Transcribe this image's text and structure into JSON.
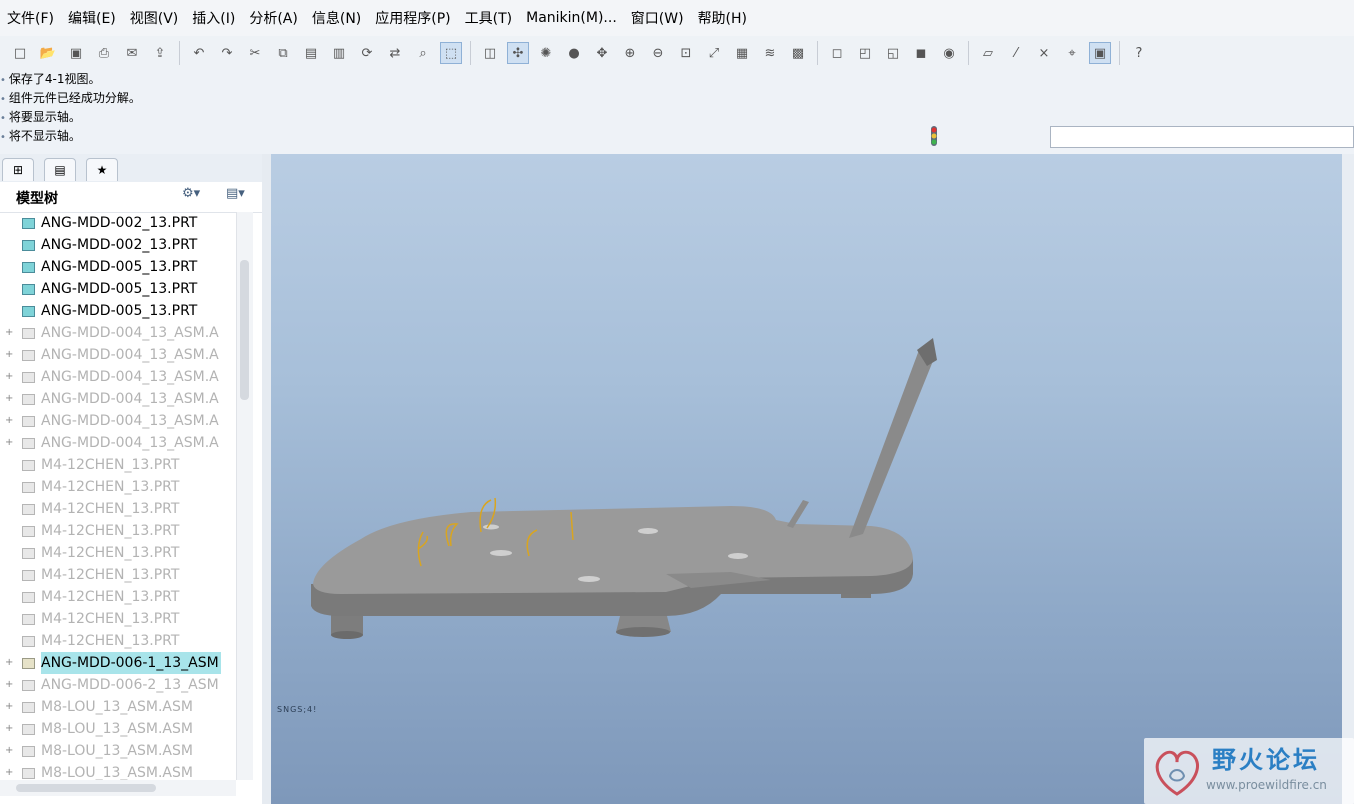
{
  "menu": [
    "文件(F)",
    "编辑(E)",
    "视图(V)",
    "插入(I)",
    "分析(A)",
    "信息(N)",
    "应用程序(P)",
    "工具(T)",
    "Manikin(M)...",
    "窗口(W)",
    "帮助(H)"
  ],
  "toolbar_groups": [
    [
      "new-file-icon",
      "open-file-icon",
      "save-icon",
      "print-icon",
      "email-icon",
      "send-icon"
    ],
    [
      "undo-icon",
      "redo-icon",
      "cut-icon",
      "copy-icon",
      "paste-icon",
      "paste-special-icon",
      "regenerate-icon",
      "regen-manager-icon",
      "find-icon",
      "select-box-icon"
    ],
    [
      "repaint-icon",
      "spin-center-icon",
      "orient-icon",
      "appearance-icon",
      "pan-icon",
      "zoom-in-icon",
      "zoom-out-icon",
      "refit-icon",
      "reorient-icon",
      "saved-views-icon",
      "layers-icon",
      "view-manager-icon"
    ],
    [
      "wireframe-icon",
      "hidden-line-icon",
      "no-hidden-icon",
      "shading-icon",
      "display-style-icon"
    ],
    [
      "datum-planes-icon",
      "datum-axes-icon",
      "datum-points-icon",
      "coordinate-systems-icon",
      "annotations-icon"
    ],
    [
      "context-help-icon"
    ]
  ],
  "messages": [
    "保存了4-1视图。",
    "组件元件已经成功分解。",
    "将要显示轴。",
    "将不显示轴。"
  ],
  "command_input": {
    "value": ""
  },
  "panel_tabs": [
    "model-tree-tab-icon",
    "layer-tree-tab-icon",
    "favorites-tab-icon"
  ],
  "tree": {
    "title": "模型树",
    "items": [
      {
        "label": "ANG-MDD-002_13.PRT",
        "kind": "part",
        "dim": false,
        "expand": false,
        "selected": false
      },
      {
        "label": "ANG-MDD-002_13.PRT",
        "kind": "part",
        "dim": false,
        "expand": false,
        "selected": false
      },
      {
        "label": "ANG-MDD-005_13.PRT",
        "kind": "part",
        "dim": false,
        "expand": false,
        "selected": false
      },
      {
        "label": "ANG-MDD-005_13.PRT",
        "kind": "part",
        "dim": false,
        "expand": false,
        "selected": false
      },
      {
        "label": "ANG-MDD-005_13.PRT",
        "kind": "part",
        "dim": false,
        "expand": false,
        "selected": false
      },
      {
        "label": "ANG-MDD-004_13_ASM.A",
        "kind": "asm",
        "dim": true,
        "expand": true,
        "selected": false
      },
      {
        "label": "ANG-MDD-004_13_ASM.A",
        "kind": "asm",
        "dim": true,
        "expand": true,
        "selected": false
      },
      {
        "label": "ANG-MDD-004_13_ASM.A",
        "kind": "asm",
        "dim": true,
        "expand": true,
        "selected": false
      },
      {
        "label": "ANG-MDD-004_13_ASM.A",
        "kind": "asm",
        "dim": true,
        "expand": true,
        "selected": false
      },
      {
        "label": "ANG-MDD-004_13_ASM.A",
        "kind": "asm",
        "dim": true,
        "expand": true,
        "selected": false
      },
      {
        "label": "ANG-MDD-004_13_ASM.A",
        "kind": "asm",
        "dim": true,
        "expand": true,
        "selected": false
      },
      {
        "label": "M4-12CHEN_13.PRT",
        "kind": "part",
        "dim": true,
        "expand": false,
        "selected": false
      },
      {
        "label": "M4-12CHEN_13.PRT",
        "kind": "part",
        "dim": true,
        "expand": false,
        "selected": false
      },
      {
        "label": "M4-12CHEN_13.PRT",
        "kind": "part",
        "dim": true,
        "expand": false,
        "selected": false
      },
      {
        "label": "M4-12CHEN_13.PRT",
        "kind": "part",
        "dim": true,
        "expand": false,
        "selected": false
      },
      {
        "label": "M4-12CHEN_13.PRT",
        "kind": "part",
        "dim": true,
        "expand": false,
        "selected": false
      },
      {
        "label": "M4-12CHEN_13.PRT",
        "kind": "part",
        "dim": true,
        "expand": false,
        "selected": false
      },
      {
        "label": "M4-12CHEN_13.PRT",
        "kind": "part",
        "dim": true,
        "expand": false,
        "selected": false
      },
      {
        "label": "M4-12CHEN_13.PRT",
        "kind": "part",
        "dim": true,
        "expand": false,
        "selected": false
      },
      {
        "label": "M4-12CHEN_13.PRT",
        "kind": "part",
        "dim": true,
        "expand": false,
        "selected": false
      },
      {
        "label": "ANG-MDD-006-1_13_ASM",
        "kind": "asm",
        "dim": false,
        "expand": true,
        "selected": true
      },
      {
        "label": "ANG-MDD-006-2_13_ASM",
        "kind": "asm",
        "dim": true,
        "expand": true,
        "selected": false
      },
      {
        "label": "M8-LOU_13_ASM.ASM",
        "kind": "asm",
        "dim": true,
        "expand": true,
        "selected": false
      },
      {
        "label": "M8-LOU_13_ASM.ASM",
        "kind": "asm",
        "dim": true,
        "expand": true,
        "selected": false
      },
      {
        "label": "M8-LOU_13_ASM.ASM",
        "kind": "asm",
        "dim": true,
        "expand": true,
        "selected": false
      },
      {
        "label": "M8-LOU_13_ASM.ASM",
        "kind": "asm",
        "dim": true,
        "expand": true,
        "selected": false
      }
    ]
  },
  "viewport": {
    "label": "SNGS;4!"
  },
  "watermark": {
    "text": "野火论坛",
    "url": "www.proewildfire.cn"
  },
  "colors": {
    "selection": "#a8e4ea",
    "part_icon": "#7fd3d8",
    "model_grey": "#8f8f8f",
    "axis_yellow": "#d9a520"
  }
}
